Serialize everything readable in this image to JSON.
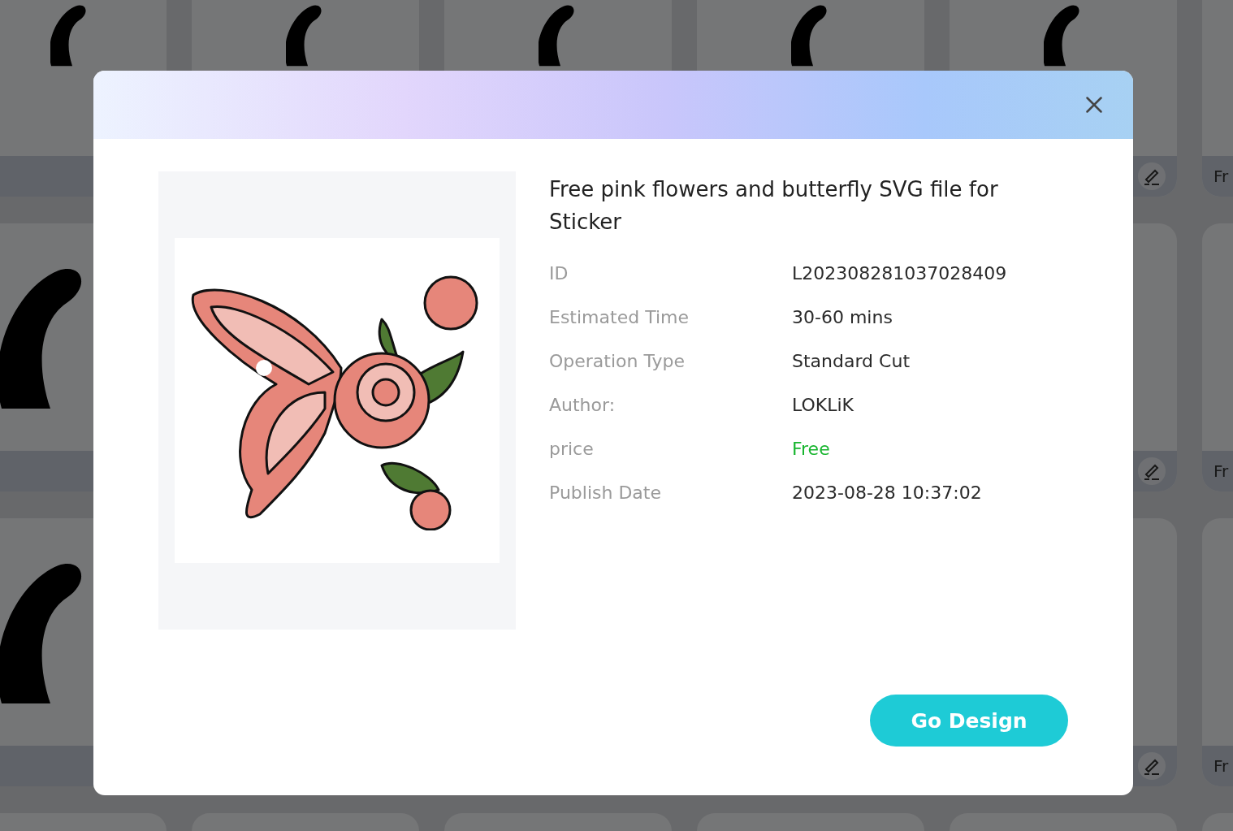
{
  "background": {
    "card_rows": [
      {
        "side_label": "Fr"
      },
      {
        "side_label": "Fr"
      },
      {
        "side_label": "Fr"
      }
    ]
  },
  "dialog": {
    "title": "Free pink flowers and butterfly SVG file for Sticker",
    "details": [
      {
        "label": "ID",
        "value": "L202308281037028409",
        "kind": "text"
      },
      {
        "label": "Estimated Time",
        "value": "30-60 mins",
        "kind": "text"
      },
      {
        "label": "Operation Type",
        "value": "Standard Cut",
        "kind": "text"
      },
      {
        "label": "Author:",
        "value": "LOKLiK",
        "kind": "text"
      },
      {
        "label": "price",
        "value": "Free",
        "kind": "free"
      },
      {
        "label": "Publish Date",
        "value": "2023-08-28 10:37:02",
        "kind": "text"
      }
    ],
    "button": "Go Design"
  }
}
